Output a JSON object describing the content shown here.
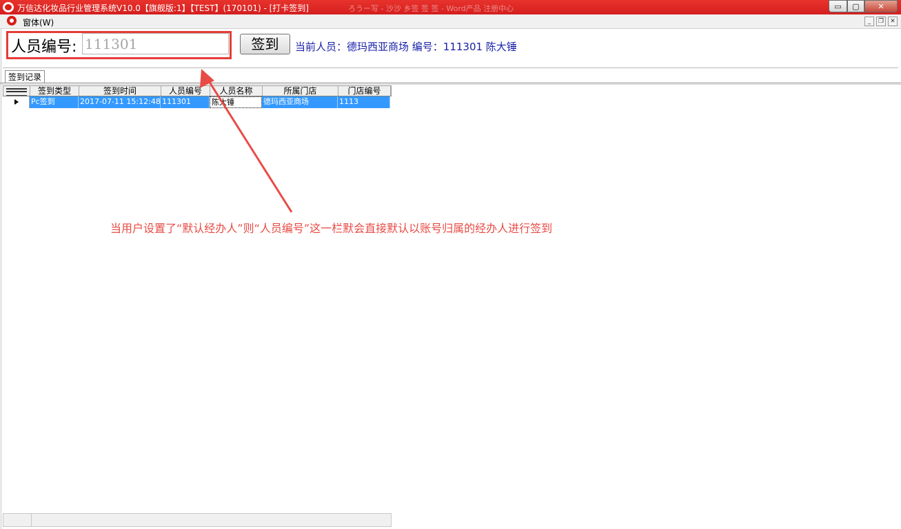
{
  "window": {
    "title": "万信达化妆品行业管理系统V10.0【旗舰版:1】【TEST】(170101) - [打卡签到]",
    "ghost_title": "ろうー写  - 沙沙  乡签  签  签  - Word产品  注册中心",
    "min_symbol": "▭",
    "max_symbol": "▢",
    "close_symbol": "✕"
  },
  "menu": {
    "window_menu": "窗体(W)",
    "mdi_min": "_",
    "mdi_restore": "❐",
    "mdi_close": "✕"
  },
  "form": {
    "label": "人员编号:",
    "employee_id_value": "111301",
    "checkin_label": "签到",
    "current_info": "当前人员：德玛西亚商场 编号：111301 陈大锤"
  },
  "tabs": [
    {
      "label": "签到记录"
    }
  ],
  "grid": {
    "columns": [
      "签到类型",
      "签到时间",
      "人员编号",
      "人员名称",
      "所属门店",
      "门店编号"
    ],
    "rows": [
      {
        "type": "Pc签到",
        "time": "2017-07-11 15:12:48",
        "emp_id": "111301",
        "name": "陈大锤",
        "store": "德玛西亚商场",
        "store_id": "1113"
      }
    ]
  },
  "annotation": "当用户设置了“默认经办人”则“人员编号”这一栏默会直接默认以账号归属的经办人进行签到",
  "colors": {
    "title_bar": "#d91e18",
    "highlight_box": "#e63b37",
    "annotation": "#e84b45",
    "selection": "#3399ff",
    "info_text": "#1a20a8"
  }
}
